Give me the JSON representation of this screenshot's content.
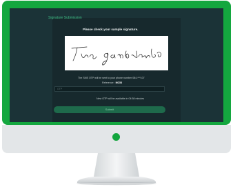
{
  "screen": {
    "panel_title": "Signature Submission",
    "heading": "Please check your sample signature.",
    "otp_info": "The SMS OTP will be sent to your phone number 084-***107",
    "reference_label": "Reference :",
    "reference_value": "MC53",
    "otp_placeholder": "OTP",
    "resend_text": "New OTP will be available in 04:58 minutes",
    "submit_label": "Submit"
  },
  "colors": {
    "frame": "#14a73f",
    "screen_bg": "#1b3337",
    "panel_bg": "#17292d",
    "accent": "#3fbf86",
    "button": "#1e6a4b"
  },
  "icons": [
    "power-indicator-icon"
  ]
}
